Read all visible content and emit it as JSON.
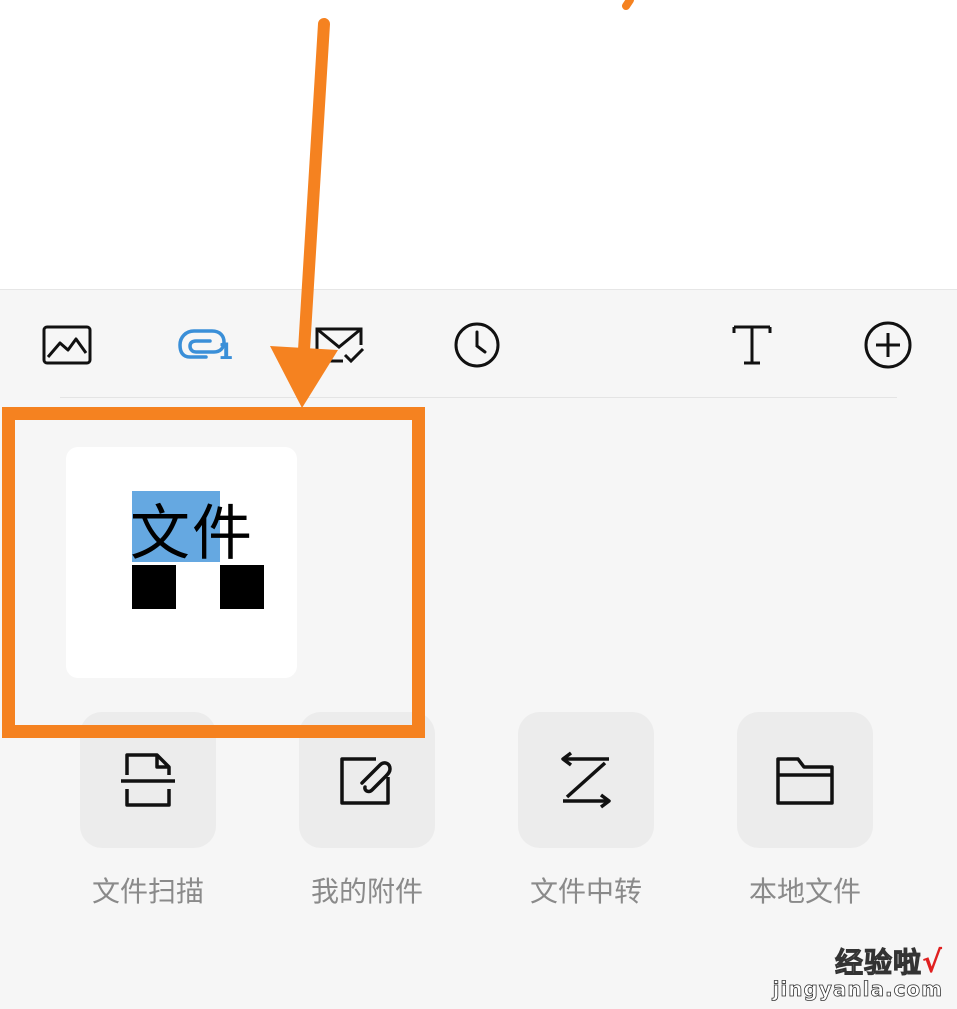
{
  "toolbar": {
    "tools": [
      {
        "icon": "image-icon"
      },
      {
        "icon": "attachment-icon",
        "badge": "1"
      },
      {
        "icon": "mail-check-icon"
      },
      {
        "icon": "clock-icon"
      },
      {
        "icon": "text-icon"
      },
      {
        "icon": "plus-circle-icon"
      }
    ],
    "accent_color": "#3a8fd8"
  },
  "file_tile": {
    "title": "文件"
  },
  "actions": [
    {
      "label": "文件扫描",
      "icon": "scan-document-icon"
    },
    {
      "label": "我的附件",
      "icon": "attachment-folder-icon"
    },
    {
      "label": "文件中转",
      "icon": "transfer-icon"
    },
    {
      "label": "本地文件",
      "icon": "folder-icon"
    }
  ],
  "annotation": {
    "color": "#f58220"
  },
  "watermark": {
    "cn": "经验啦",
    "check": "√",
    "en": "jingyanla.com"
  }
}
